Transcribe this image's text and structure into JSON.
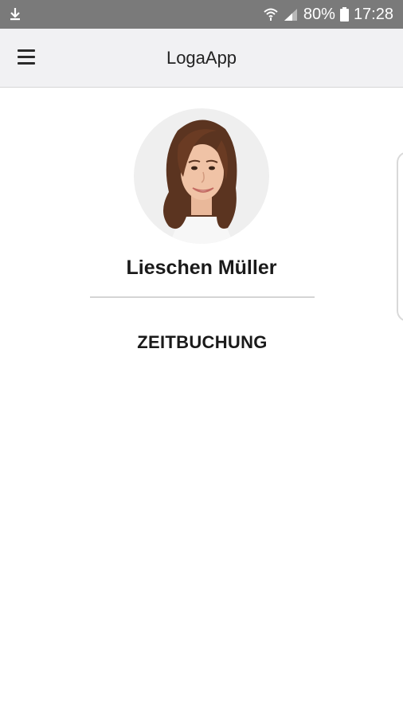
{
  "status_bar": {
    "download_icon": "download-icon",
    "wifi_icon": "wifi-icon",
    "signal_icon": "signal-icon",
    "battery_percent": "80%",
    "battery_icon": "battery-icon",
    "time": "17:28"
  },
  "app_bar": {
    "menu_icon": "hamburger-menu-icon",
    "title": "LogaApp"
  },
  "profile": {
    "name": "Lieschen Müller"
  },
  "menu": {
    "items": [
      {
        "label": "ZEITBUCHUNG"
      }
    ]
  },
  "colors": {
    "status_bar_bg": "#7a7a7a",
    "app_bar_bg": "#f1f1f3",
    "avatar_bg": "#efefef",
    "divider": "#d4d4d4"
  }
}
